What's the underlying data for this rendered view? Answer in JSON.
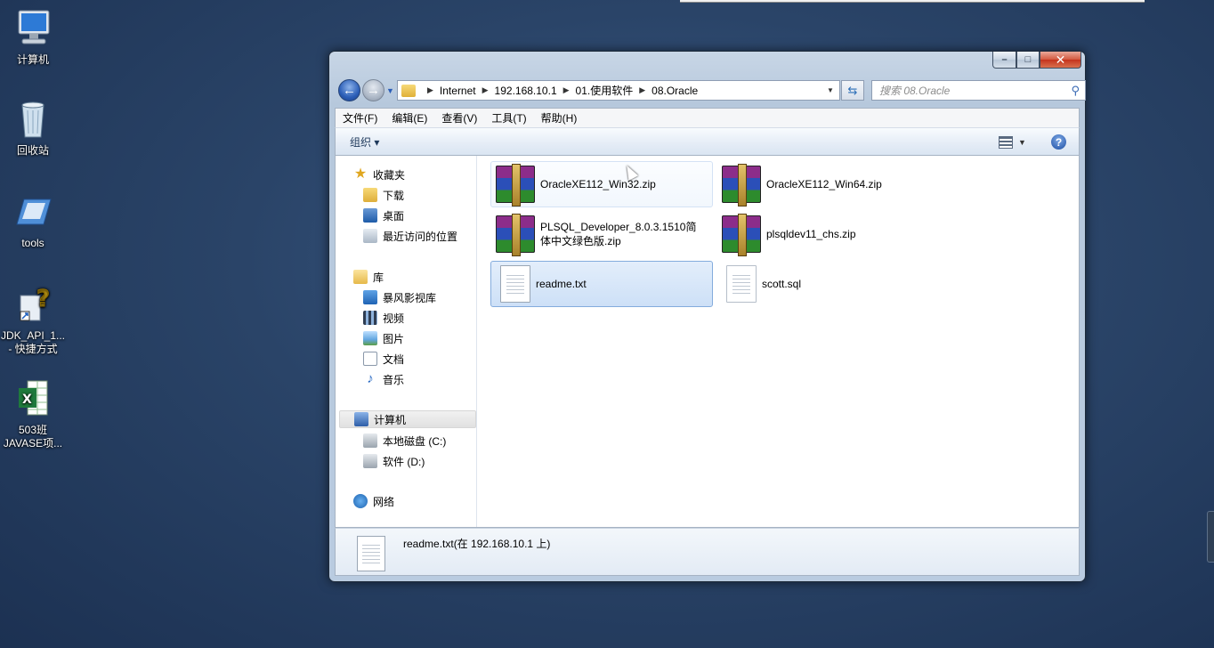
{
  "desktop": {
    "icons": [
      {
        "label": "计算机"
      },
      {
        "label": "回收站"
      },
      {
        "label": "tools"
      },
      {
        "label": "JDK_API_1...\n- 快捷方式"
      },
      {
        "label": "503班\nJAVASE项..."
      }
    ]
  },
  "window": {
    "caption_buttons": {
      "minimize": "–",
      "maximize": "□",
      "close": "✕"
    },
    "nav": {
      "back_glyph": "←",
      "forward_glyph": "→",
      "breadcrumb": [
        "Internet",
        "192.168.10.1",
        "01.使用软件",
        "08.Oracle"
      ],
      "search_placeholder": "搜索 08.Oracle"
    },
    "menu": [
      "文件(F)",
      "编辑(E)",
      "查看(V)",
      "工具(T)",
      "帮助(H)"
    ],
    "command_bar": {
      "organize": "组织 ▾",
      "help": "?"
    },
    "nav_pane": {
      "favorites": {
        "label": "收藏夹",
        "items": [
          "下载",
          "桌面",
          "最近访问的位置"
        ]
      },
      "libraries": {
        "label": "库",
        "items": [
          "暴风影视库",
          "视频",
          "图片",
          "文档",
          "音乐"
        ]
      },
      "computer": {
        "label": "计算机",
        "items": [
          "本地磁盘 (C:)",
          "软件 (D:)"
        ]
      },
      "network": {
        "label": "网络"
      }
    },
    "files": [
      {
        "name": "OracleXE112_Win32.zip",
        "type": "zip"
      },
      {
        "name": "OracleXE112_Win64.zip",
        "type": "zip"
      },
      {
        "name": "PLSQL_Developer_8.0.3.1510简体中文绿色版.zip",
        "type": "zip"
      },
      {
        "name": "plsqldev11_chs.zip",
        "type": "zip"
      },
      {
        "name": "readme.txt",
        "type": "txt"
      },
      {
        "name": "scott.sql",
        "type": "sql"
      }
    ],
    "details": {
      "text": "readme.txt(在 192.168.10.1 上)"
    }
  },
  "colors": {
    "selection": "#cde0f7",
    "accent": "#2b5eb7"
  }
}
